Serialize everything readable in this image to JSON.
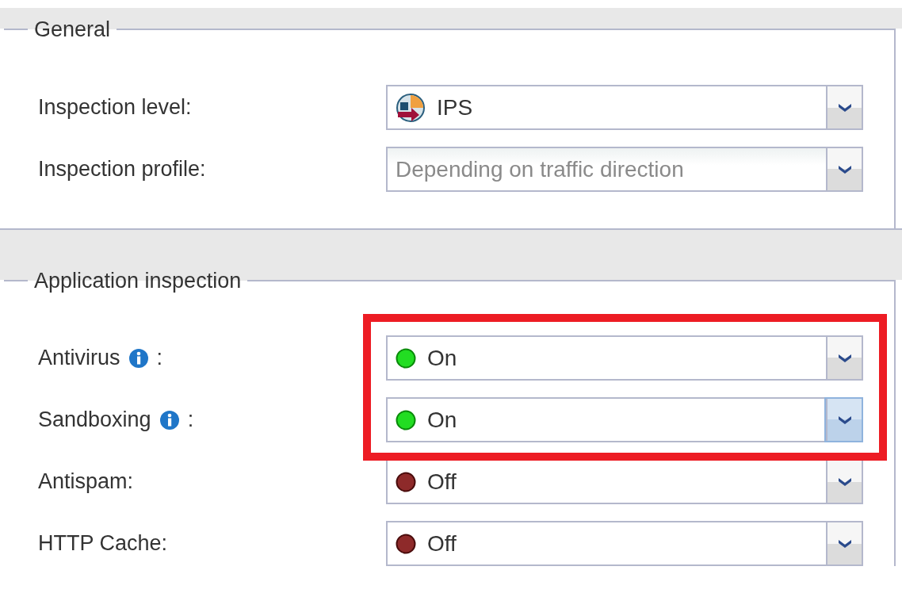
{
  "sections": [
    {
      "legend": "General",
      "rows": [
        {
          "label": "Inspection level:",
          "value": "IPS",
          "kind": "level",
          "disabled": false,
          "hovered": false
        },
        {
          "label": "Inspection profile:",
          "value": "Depending on traffic direction",
          "kind": "text",
          "disabled": true,
          "hovered": false
        }
      ]
    },
    {
      "legend": "Application inspection",
      "rows": [
        {
          "kind": "highlight_group",
          "rows": [
            {
              "label": "Antivirus",
              "info": true,
              "suffix": ":",
              "value": "On",
              "kind": "status",
              "on": true,
              "disabled": false,
              "hovered": false
            },
            {
              "label": "Sandboxing",
              "info": true,
              "suffix": ":",
              "value": "On",
              "kind": "status",
              "on": true,
              "disabled": false,
              "hovered": true
            }
          ]
        },
        {
          "label": "Antispam:",
          "info": false,
          "value": "Off",
          "kind": "status",
          "on": false,
          "disabled": false,
          "hovered": false
        },
        {
          "label": "HTTP Cache:",
          "info": false,
          "value": "Off",
          "kind": "status",
          "on": false,
          "disabled": false,
          "hovered": false
        }
      ]
    }
  ]
}
